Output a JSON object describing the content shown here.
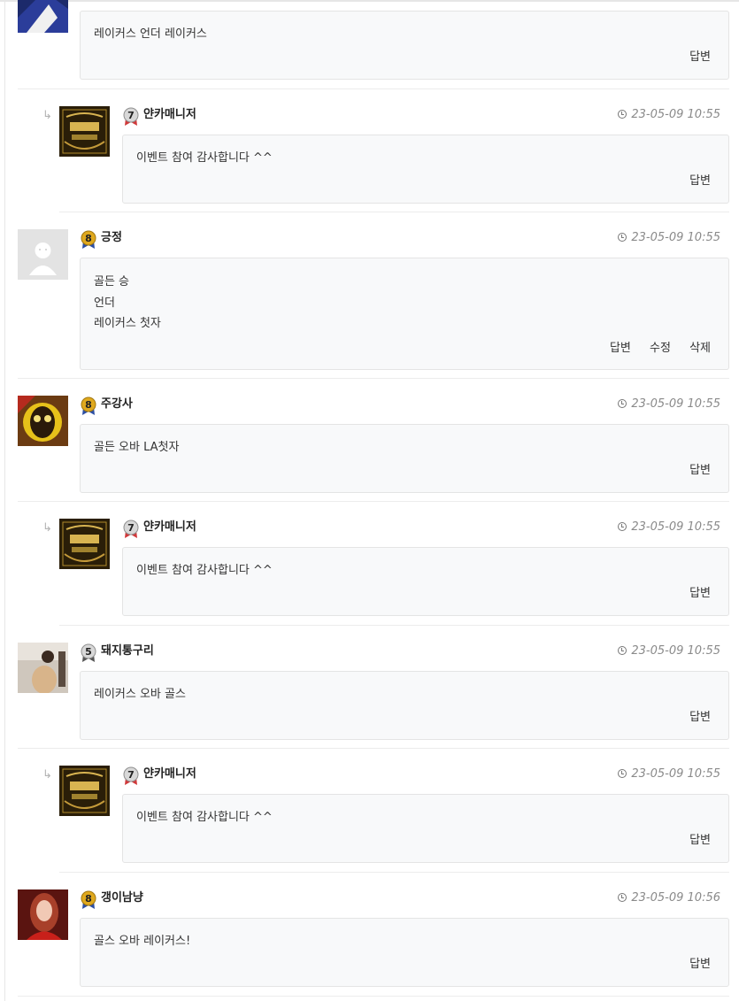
{
  "comments": [
    {
      "id": "c1",
      "nickname": "",
      "level": "",
      "time": "",
      "text": "레이커스 언더 레이커스",
      "actions": [
        "답변"
      ],
      "avatar": "dark-blue-photo-avatar"
    },
    {
      "id": "c2",
      "nickname": "얀카매니저",
      "level": "7",
      "time": "23-05-09 10:55",
      "text": "이벤트 참여 감사합니다 ^^",
      "actions": [
        "답변"
      ],
      "avatar": "gold-logo-avatar",
      "reply": true
    },
    {
      "id": "c3",
      "nickname": "긍정",
      "level": "8",
      "time": "23-05-09 10:55",
      "text": "골든 승\n언더\n레이커스 첫자",
      "actions": [
        "답변",
        "수정",
        "삭제"
      ],
      "avatar": "default-user-avatar"
    },
    {
      "id": "c4",
      "nickname": "주강사",
      "level": "8",
      "time": "23-05-09 10:55",
      "text": "골든 오바 LA첫자",
      "actions": [
        "답변"
      ],
      "avatar": "yellow-character-avatar"
    },
    {
      "id": "c5",
      "nickname": "얀카매니저",
      "level": "7",
      "time": "23-05-09 10:55",
      "text": "이벤트 참여 감사합니다 ^^",
      "actions": [
        "답변"
      ],
      "avatar": "gold-logo-avatar",
      "reply": true
    },
    {
      "id": "c6",
      "nickname": "돼지통구리",
      "level": "5",
      "time": "23-05-09 10:55",
      "text": "레이커스 오바 골스",
      "actions": [
        "답변"
      ],
      "avatar": "person-photo-avatar"
    },
    {
      "id": "c7",
      "nickname": "얀카매니저",
      "level": "7",
      "time": "23-05-09 10:55",
      "text": "이벤트 참여 감사합니다 ^^",
      "actions": [
        "답변"
      ],
      "avatar": "gold-logo-avatar",
      "reply": true
    },
    {
      "id": "c8",
      "nickname": "갱이남냥",
      "level": "8",
      "time": "23-05-09 10:56",
      "text": "골스 오바 레이커스!",
      "actions": [
        "답변"
      ],
      "avatar": "red-hair-photo-avatar"
    }
  ],
  "colors": {
    "box_bg": "#f8f9fa",
    "box_border": "#e4e4e4",
    "time_text": "#8a8a8a",
    "level_gold": "#e0a91e",
    "level_silver": "#9a9a9a",
    "ribbon_red": "#d0383a"
  }
}
